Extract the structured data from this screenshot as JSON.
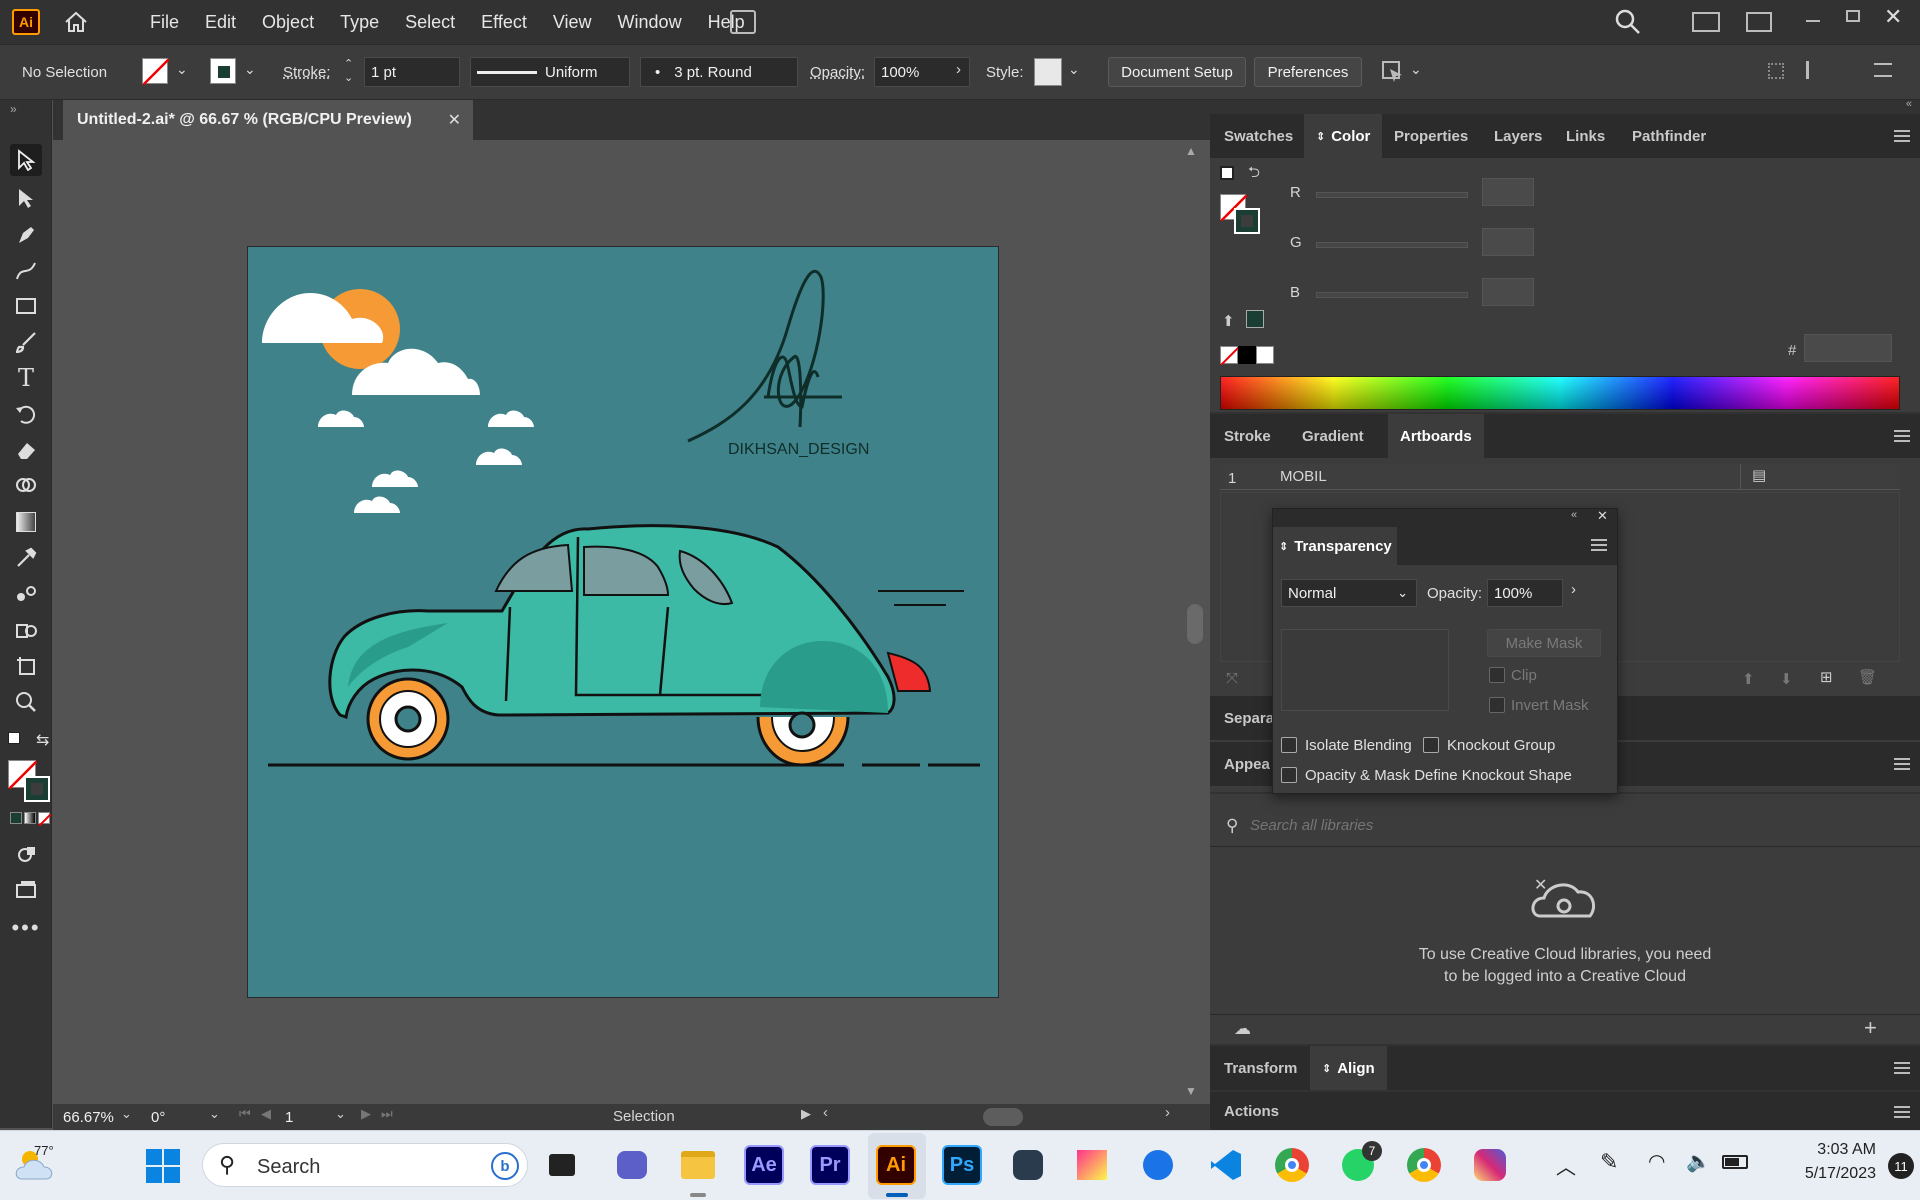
{
  "app": {
    "logo": "Ai"
  },
  "menu": [
    "File",
    "Edit",
    "Object",
    "Type",
    "Select",
    "Effect",
    "View",
    "Window",
    "Help"
  ],
  "control": {
    "selection": "No Selection",
    "stroke_label": "Stroke:",
    "stroke_value": "1 pt",
    "profile": "Uniform",
    "brush": "3 pt. Round",
    "opacity_label": "Opacity:",
    "opacity_value": "100%",
    "style_label": "Style:",
    "doc_setup": "Document Setup",
    "preferences": "Preferences"
  },
  "document": {
    "tab_title": "Untitled-2.ai* @ 66.67 % (RGB/CPU Preview)"
  },
  "artwork": {
    "signature_text": "DIKHSAN_DESIGN",
    "colors": {
      "background": "#3f8289",
      "car": "#3dbaa6",
      "wheel": "#f59a35",
      "tail": "#ee2c2c"
    }
  },
  "status": {
    "zoom": "66.67%",
    "rotation": "0°",
    "artboard_num": "1",
    "tool": "Selection"
  },
  "panels": {
    "top_tabs": [
      "Swatches",
      "Color",
      "Properties",
      "Layers",
      "Links",
      "Pathfinder"
    ],
    "active_top": "Color",
    "color": {
      "r_label": "R",
      "g_label": "G",
      "b_label": "B",
      "hex_label": "#",
      "accent": "#1a3d34"
    },
    "mid_tabs": [
      "Stroke",
      "Gradient",
      "Artboards"
    ],
    "active_mid": "Artboards",
    "artboards": [
      {
        "num": "1",
        "name": "MOBIL"
      }
    ],
    "separations_partial": "Separa",
    "appearance_partial": "Appea",
    "libraries": {
      "search_placeholder": "Search all libraries",
      "message_line1": "To use Creative Cloud libraries, you need",
      "message_line2": "to be logged into a Creative Cloud"
    },
    "bottom_tabs": [
      "Transform",
      "Align"
    ],
    "active_bottom": "Align",
    "actions": "Actions"
  },
  "transparency": {
    "title": "Transparency",
    "blend_mode": "Normal",
    "opacity_label": "Opacity:",
    "opacity_value": "100%",
    "make_mask": "Make Mask",
    "clip": "Clip",
    "invert_mask": "Invert Mask",
    "isolate": "Isolate Blending",
    "knockout": "Knockout Group",
    "opacity_mask": "Opacity & Mask Define Knockout Shape"
  },
  "taskbar": {
    "weather": "77°",
    "search": "Search",
    "time": "3:03 AM",
    "date": "5/17/2023",
    "notif_count": "11",
    "whatsapp_badge": "7",
    "apps": [
      {
        "label": "Ae"
      },
      {
        "label": "Pr"
      },
      {
        "label": "Ai"
      },
      {
        "label": "Ps"
      }
    ]
  }
}
